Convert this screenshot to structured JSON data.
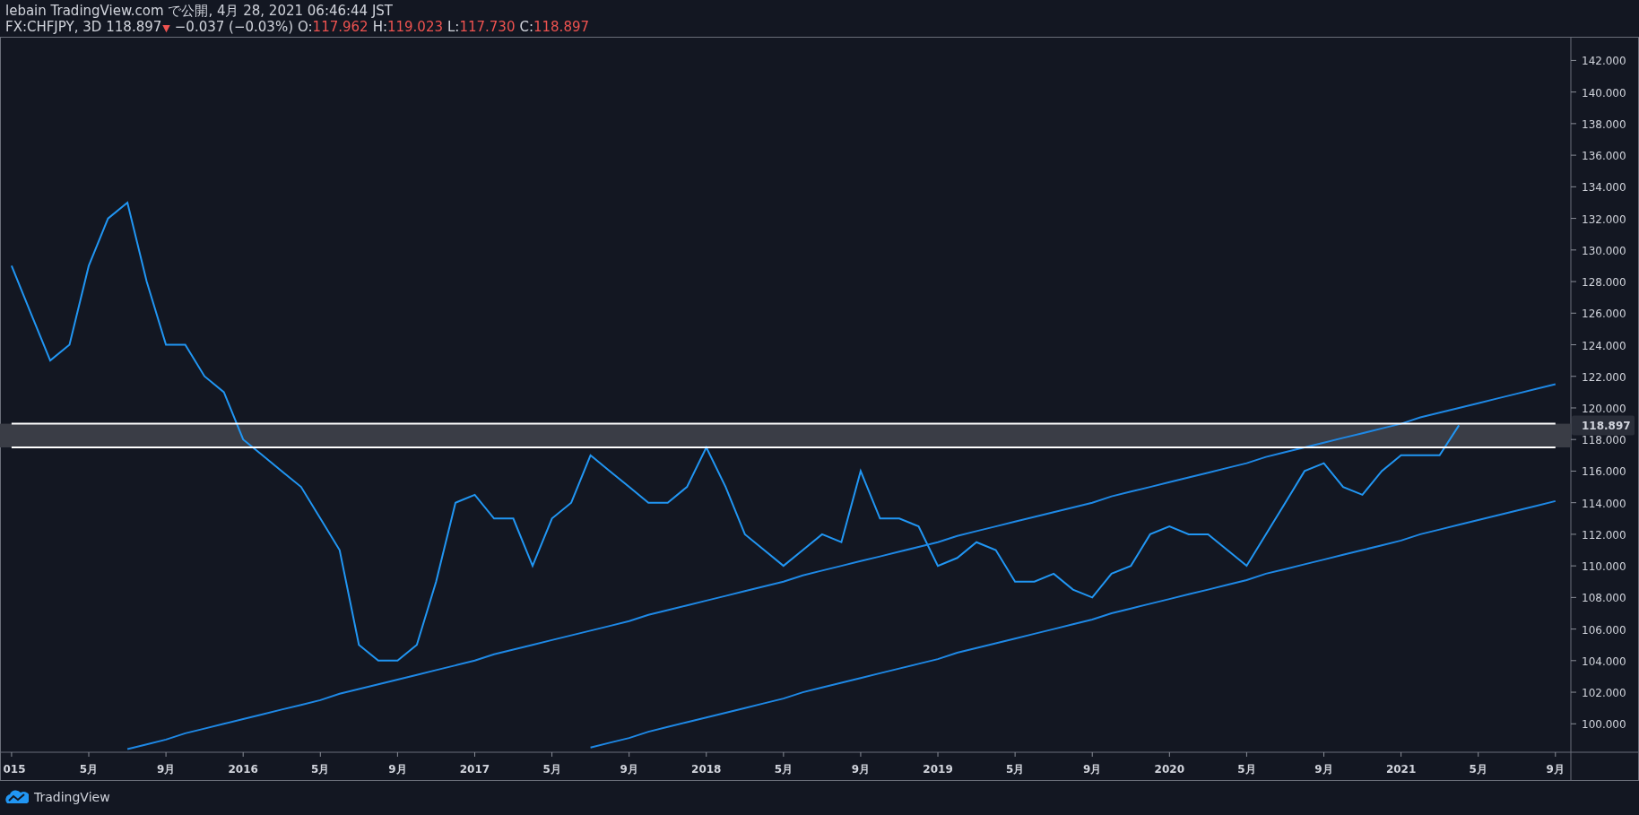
{
  "header": {
    "publisher": "lebain TradingView.com で公開, 4月 28, 2021 06:46:44 JST",
    "symbol": "FX:CHFJPY, 3D",
    "last": "118.897",
    "direction": "▼",
    "change": "−0.037 (−0.03%)",
    "ohlc": [
      {
        "label": "O:",
        "value": "117.962"
      },
      {
        "label": "H:",
        "value": "119.023"
      },
      {
        "label": "L:",
        "value": "117.730"
      },
      {
        "label": "C:",
        "value": "118.897"
      }
    ]
  },
  "chart_data": {
    "type": "line",
    "ylim": [
      98.2,
      143.5
    ],
    "categories": [
      "015",
      null,
      null,
      null,
      "5月",
      null,
      null,
      null,
      "9月",
      null,
      null,
      null,
      "2016",
      null,
      null,
      null,
      "5月",
      null,
      null,
      null,
      "9月",
      null,
      null,
      null,
      "2017",
      null,
      null,
      null,
      "5月",
      null,
      null,
      null,
      "9月",
      null,
      null,
      null,
      "2018",
      null,
      null,
      null,
      "5月",
      null,
      null,
      null,
      "9月",
      null,
      null,
      null,
      "2019",
      null,
      null,
      null,
      "5月",
      null,
      null,
      null,
      "9月",
      null,
      null,
      null,
      "2020",
      null,
      null,
      null,
      "5月",
      null,
      null,
      null,
      "9月",
      null,
      null,
      null,
      "2021",
      null,
      null,
      null,
      "5月",
      null,
      null,
      null,
      "9月"
    ],
    "series": [
      {
        "color": "#2196f3",
        "values": [
          129,
          126,
          123,
          124,
          129,
          132,
          133,
          128,
          124,
          124,
          122,
          121,
          118,
          117,
          116,
          115,
          113,
          111,
          105,
          104,
          104,
          105,
          109,
          114,
          114.5,
          113,
          113,
          110,
          113,
          114,
          117,
          116,
          115,
          114,
          114,
          115,
          117.5,
          115,
          112,
          111,
          110,
          111,
          112,
          111.5,
          116,
          113,
          113,
          112.5,
          110,
          110.5,
          111.5,
          111,
          109,
          109,
          109.5,
          108.5,
          108,
          109.5,
          110,
          112,
          112.5,
          112,
          112,
          111,
          110,
          112,
          114,
          116,
          116.5,
          115,
          114.5,
          116,
          117,
          117,
          117,
          118.9,
          null,
          null,
          null,
          null,
          null
        ]
      },
      {
        "color": "#1e88e5",
        "values": [
          null,
          null,
          null,
          null,
          null,
          null,
          98.4,
          98.7,
          99.0,
          99.4,
          99.7,
          100.0,
          100.3,
          100.6,
          100.9,
          101.2,
          101.5,
          101.9,
          102.2,
          102.5,
          102.8,
          103.1,
          103.4,
          103.7,
          104.0,
          104.4,
          104.7,
          105.0,
          105.3,
          105.6,
          105.9,
          106.2,
          106.5,
          106.9,
          107.2,
          107.5,
          107.8,
          108.1,
          108.4,
          108.7,
          109.0,
          109.4,
          109.7,
          110.0,
          110.3,
          110.6,
          110.9,
          111.2,
          111.5,
          111.9,
          112.2,
          112.5,
          112.8,
          113.1,
          113.4,
          113.7,
          114.0,
          114.4,
          114.7,
          115.0,
          115.3,
          115.6,
          115.9,
          116.2,
          116.5,
          116.9,
          117.2,
          117.5,
          117.8,
          118.1,
          118.4,
          118.7,
          119.0,
          119.4,
          119.7,
          120.0,
          120.3,
          120.6,
          120.9,
          121.2,
          121.5
        ]
      },
      {
        "color": "#1e88e5",
        "values": [
          null,
          null,
          null,
          null,
          null,
          null,
          null,
          null,
          null,
          null,
          null,
          null,
          null,
          null,
          null,
          null,
          null,
          null,
          null,
          null,
          null,
          null,
          null,
          null,
          null,
          null,
          null,
          null,
          null,
          null,
          98.5,
          98.8,
          99.1,
          99.5,
          99.8,
          100.1,
          100.4,
          100.7,
          101.0,
          101.3,
          101.6,
          102.0,
          102.3,
          102.6,
          102.9,
          103.2,
          103.5,
          103.8,
          104.1,
          104.5,
          104.8,
          105.1,
          105.4,
          105.7,
          106.0,
          106.3,
          106.6,
          107.0,
          107.3,
          107.6,
          107.9,
          108.2,
          108.5,
          108.8,
          109.1,
          109.5,
          109.8,
          110.1,
          110.4,
          110.7,
          111.0,
          111.3,
          111.6,
          112.0,
          112.3,
          112.6,
          112.9,
          113.2,
          113.5,
          113.8,
          114.1
        ]
      },
      {
        "color": "#ffffff",
        "values": [
          119,
          119,
          119,
          119,
          119,
          119,
          119,
          119,
          119,
          119,
          119,
          119,
          119,
          119,
          119,
          119,
          119,
          119,
          119,
          119,
          119,
          119,
          119,
          119,
          119,
          119,
          119,
          119,
          119,
          119,
          119,
          119,
          119,
          119,
          119,
          119,
          119,
          119,
          119,
          119,
          119,
          119,
          119,
          119,
          119,
          119,
          119,
          119,
          119,
          119,
          119,
          119,
          119,
          119,
          119,
          119,
          119,
          119,
          119,
          119,
          119,
          119,
          119,
          119,
          119,
          119,
          119,
          119,
          119,
          119,
          119,
          119,
          119,
          119,
          119,
          119,
          119,
          119,
          119,
          119,
          119
        ]
      },
      {
        "color": "#ffffff",
        "values": [
          117.5,
          117.5,
          117.5,
          117.5,
          117.5,
          117.5,
          117.5,
          117.5,
          117.5,
          117.5,
          117.5,
          117.5,
          117.5,
          117.5,
          117.5,
          117.5,
          117.5,
          117.5,
          117.5,
          117.5,
          117.5,
          117.5,
          117.5,
          117.5,
          117.5,
          117.5,
          117.5,
          117.5,
          117.5,
          117.5,
          117.5,
          117.5,
          117.5,
          117.5,
          117.5,
          117.5,
          117.5,
          117.5,
          117.5,
          117.5,
          117.5,
          117.5,
          117.5,
          117.5,
          117.5,
          117.5,
          117.5,
          117.5,
          117.5,
          117.5,
          117.5,
          117.5,
          117.5,
          117.5,
          117.5,
          117.5,
          117.5,
          117.5,
          117.5,
          117.5,
          117.5,
          117.5,
          117.5,
          117.5,
          117.5,
          117.5,
          117.5,
          117.5,
          117.5,
          117.5,
          117.5,
          117.5,
          117.5,
          117.5,
          117.5,
          117.5,
          117.5,
          117.5,
          117.5,
          117.5,
          117.5
        ]
      }
    ],
    "yticks": [
      {
        "value": 100,
        "label": "100.000"
      },
      {
        "value": 102,
        "label": "102.000"
      },
      {
        "value": 104,
        "label": "104.000"
      },
      {
        "value": 106,
        "label": "106.000"
      },
      {
        "value": 108,
        "label": "108.000"
      },
      {
        "value": 110,
        "label": "110.000"
      },
      {
        "value": 112,
        "label": "112.000"
      },
      {
        "value": 114,
        "label": "114.000"
      },
      {
        "value": 116,
        "label": "116.000"
      },
      {
        "value": 118,
        "label": "118.000"
      },
      {
        "value": 120,
        "label": "120.000"
      },
      {
        "value": 122,
        "label": "122.000"
      },
      {
        "value": 124,
        "label": "124.000"
      },
      {
        "value": 126,
        "label": "126.000"
      },
      {
        "value": 128,
        "label": "128.000"
      },
      {
        "value": 130,
        "label": "130.000"
      },
      {
        "value": 132,
        "label": "132.000"
      },
      {
        "value": 134,
        "label": "134.000"
      },
      {
        "value": 136,
        "label": "136.000"
      },
      {
        "value": 138,
        "label": "138.000"
      },
      {
        "value": 140,
        "label": "140.000"
      },
      {
        "value": 142,
        "label": "142.000"
      }
    ]
  },
  "price_tag": "118.897",
  "footer": {
    "brand": "TradingView"
  }
}
